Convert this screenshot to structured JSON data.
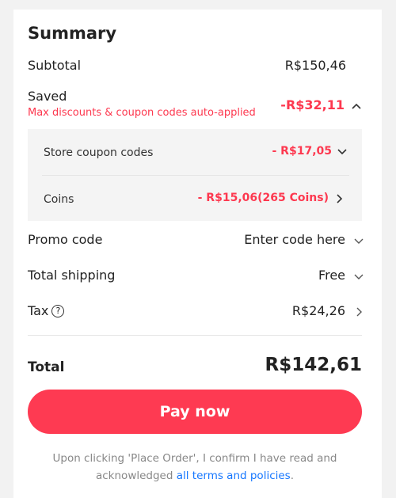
{
  "summary": {
    "title": "Summary",
    "subtotal": {
      "label": "Subtotal",
      "value": "R$150,46"
    },
    "saved": {
      "label": "Saved",
      "note": "Max discounts & coupon codes auto-applied",
      "value": "-R$32,11",
      "details": [
        {
          "label": "Store coupon codes",
          "value": "- R$17,05"
        },
        {
          "label": "Coins",
          "value": "- R$15,06(265 Coins)"
        }
      ]
    },
    "promo": {
      "label": "Promo code",
      "value": "Enter code here"
    },
    "shipping": {
      "label": "Total shipping",
      "value": "Free"
    },
    "tax": {
      "label": "Tax",
      "help": "?",
      "value": "R$24,26"
    },
    "total": {
      "label": "Total",
      "value": "R$142,61"
    },
    "pay_button": "Pay now",
    "disclaimer": {
      "text": "Upon clicking 'Place Order', I confirm I have read and acknowledged ",
      "link": "all terms and policies",
      "end": "."
    }
  },
  "colors": {
    "accent": "#fe3a52",
    "discount": "#fd384f",
    "link": "#1677ff"
  }
}
